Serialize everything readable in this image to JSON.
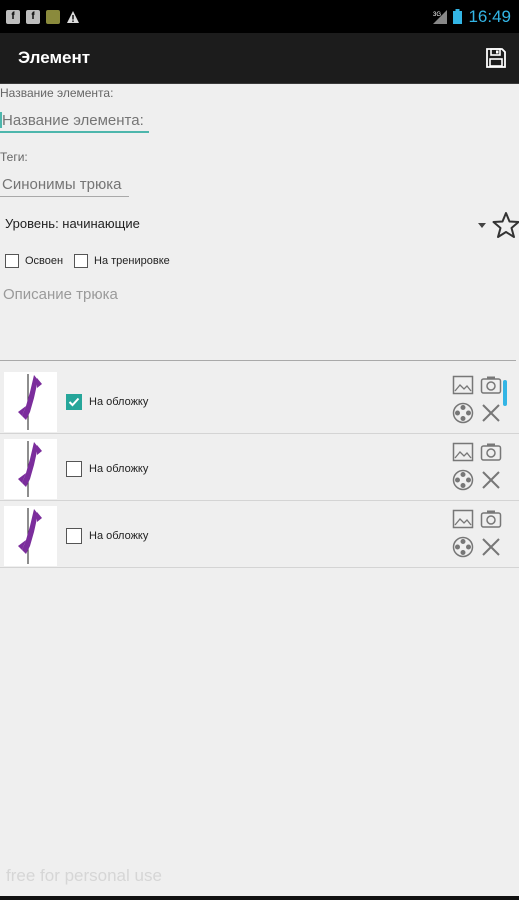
{
  "statusbar": {
    "left_icons": [
      "notification-f-icon",
      "notification-f-icon",
      "notification-gallery-icon",
      "warning-icon"
    ],
    "network": "3G",
    "time": "16:49"
  },
  "actionbar": {
    "title": "Элемент",
    "save_icon": "save-icon"
  },
  "form": {
    "name_label": "Название элемента:",
    "name_placeholder": "Название элемента:",
    "tags_label": "Теги:",
    "tags_placeholder": "Синонимы трюка",
    "level": "Уровень: начинающие",
    "checkbox_mastered": "Освоен",
    "checkbox_training": "На тренировке",
    "description_placeholder": "Описание трюка"
  },
  "list": {
    "items": [
      {
        "label": "На обложку",
        "checked": true
      },
      {
        "label": "На обложку",
        "checked": false
      },
      {
        "label": "На обложку",
        "checked": false
      }
    ]
  },
  "watermark": "free for personal use",
  "colors": {
    "accent_teal": "#26a69a",
    "holo_blue": "#33b5e5",
    "figure_purple": "#7b2d9c"
  }
}
